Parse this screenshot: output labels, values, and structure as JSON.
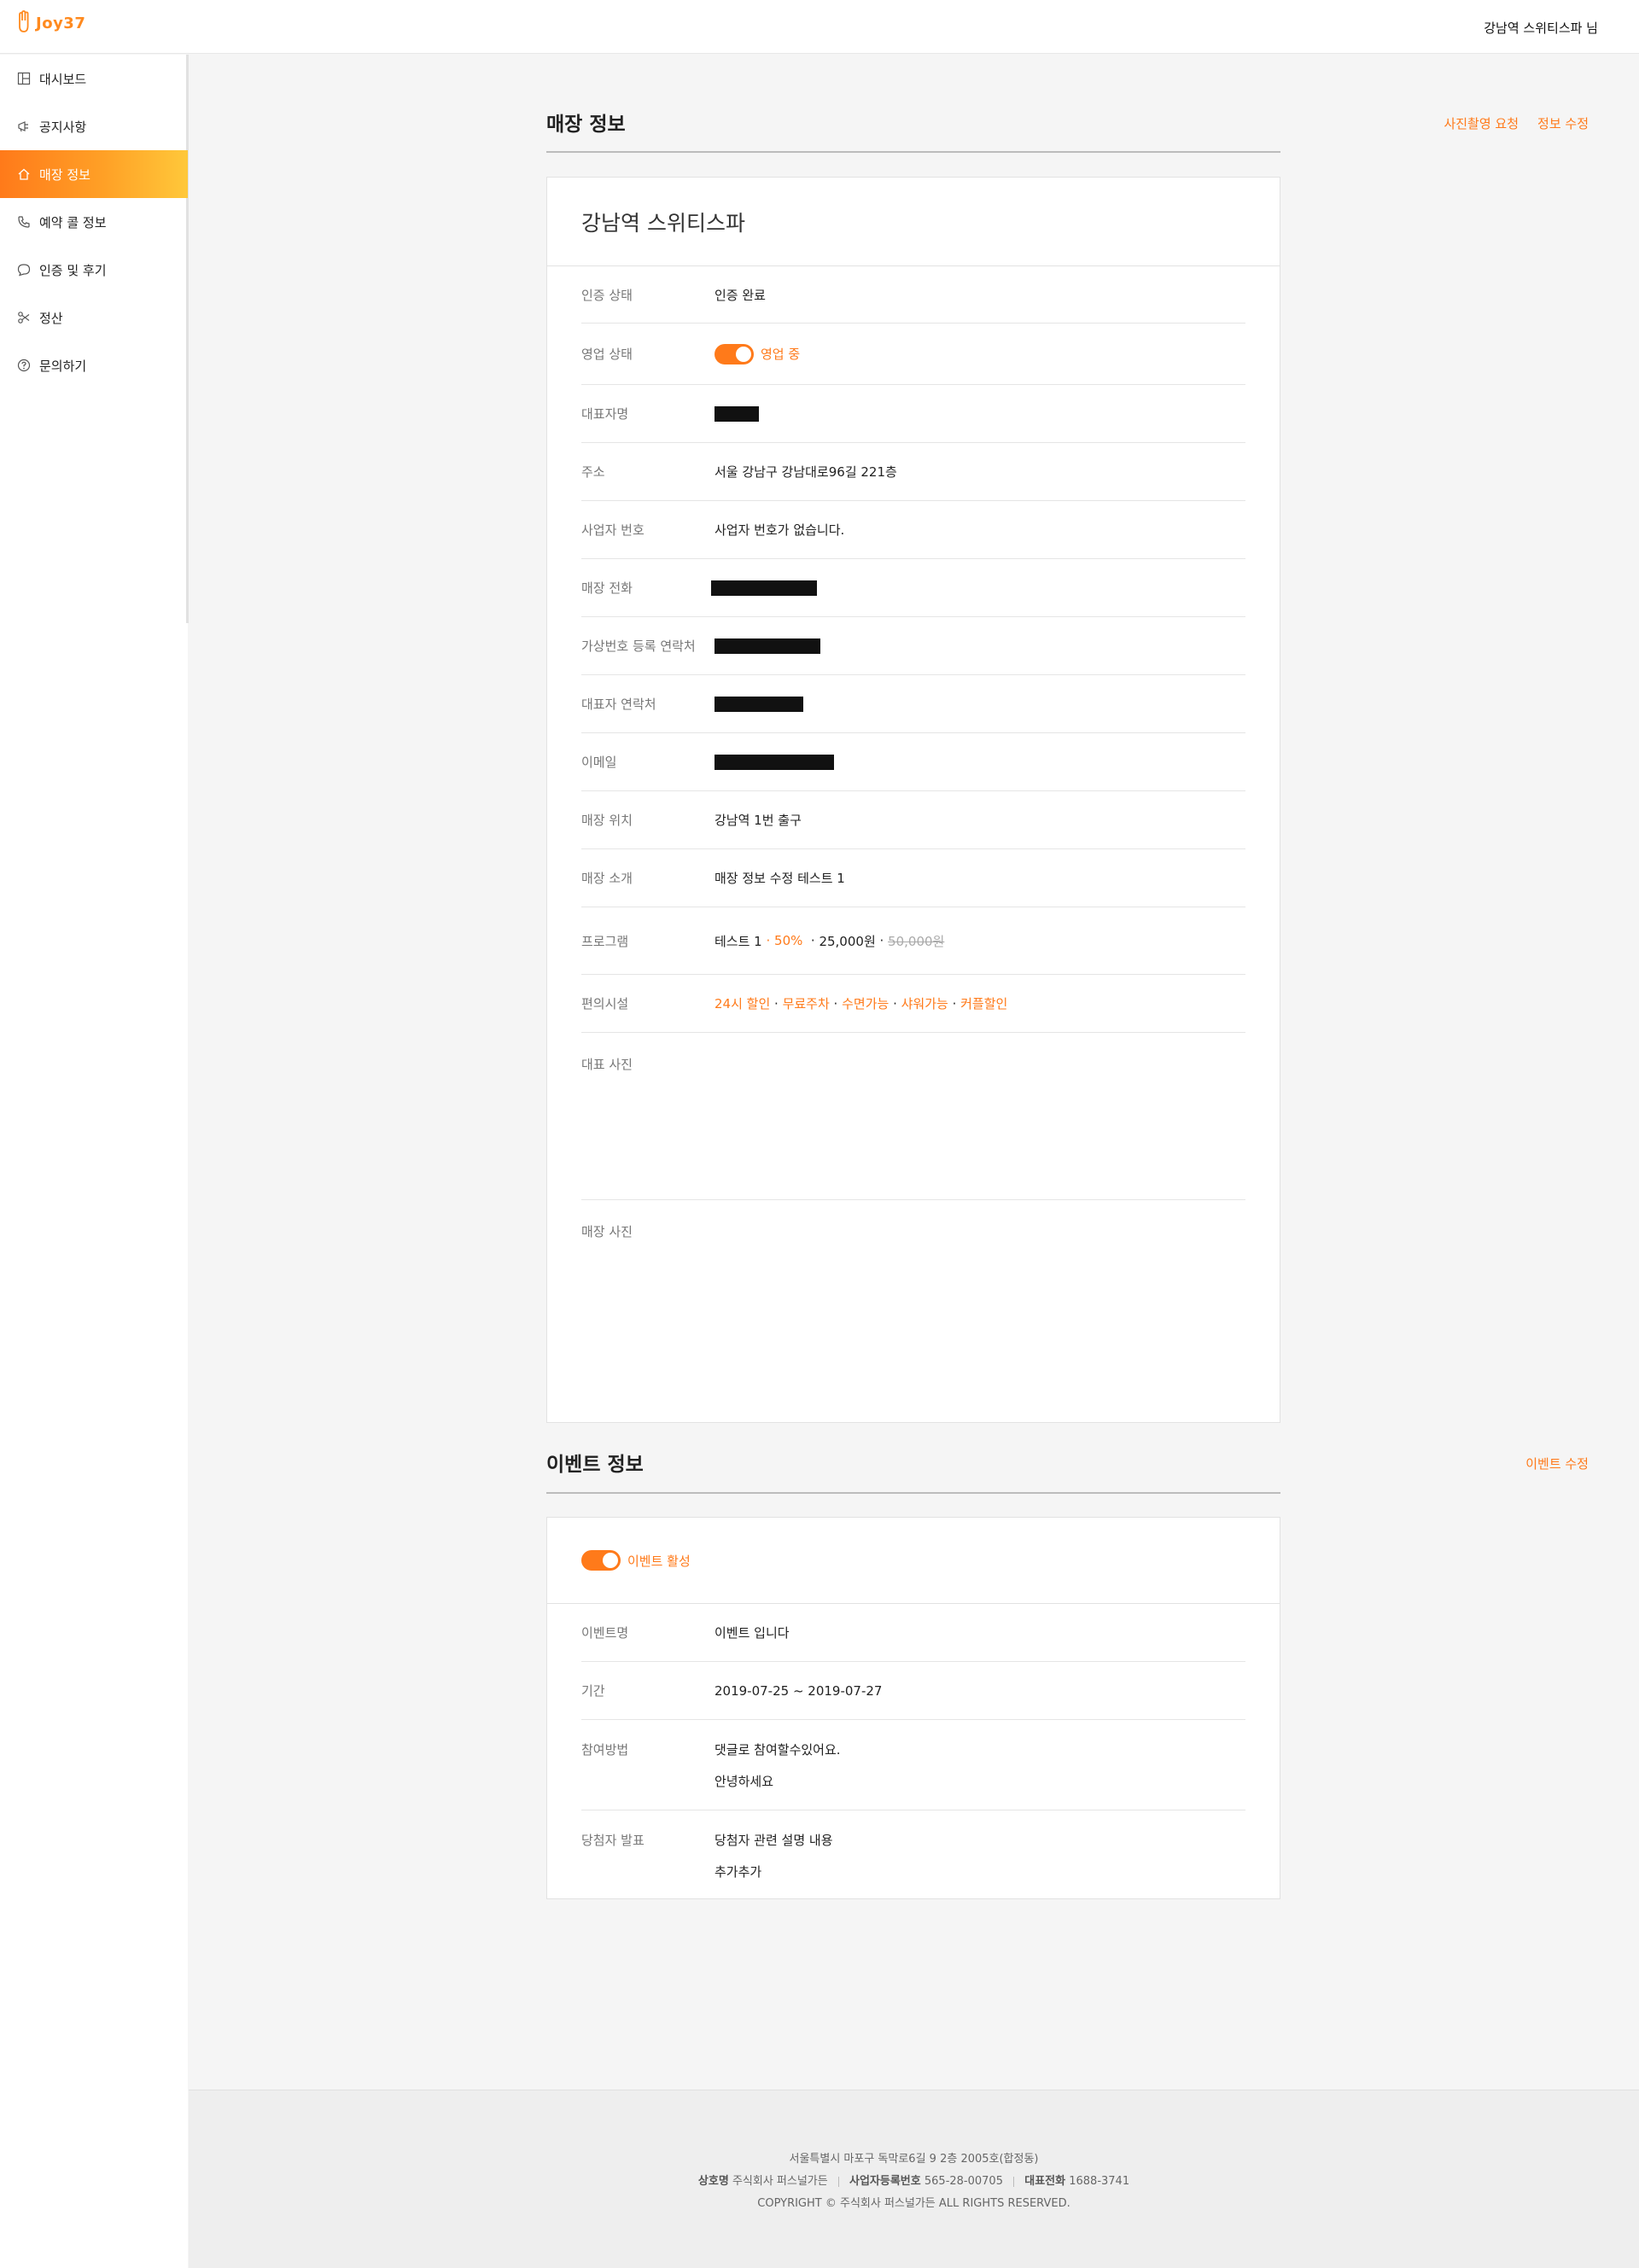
{
  "header": {
    "logo_text": "Joy37",
    "user_label": "강남역 스위티스파 님"
  },
  "sidebar": {
    "items": [
      {
        "label": "대시보드",
        "icon": "dashboard-icon"
      },
      {
        "label": "공지사항",
        "icon": "megaphone-icon"
      },
      {
        "label": "매장 정보",
        "icon": "home-icon",
        "active": true
      },
      {
        "label": "예약 콜 정보",
        "icon": "phone-icon"
      },
      {
        "label": "인증 및 후기",
        "icon": "chat-bubble-icon"
      },
      {
        "label": "정산",
        "icon": "scissors-icon"
      },
      {
        "label": "문의하기",
        "icon": "question-icon"
      }
    ]
  },
  "store_section": {
    "title": "매장 정보",
    "actions": {
      "photo_request": "사진촬영 요청",
      "edit_info": "정보 수정"
    },
    "store_name": "강남역 스위티스파",
    "labels": {
      "cert_status": "인증 상태",
      "business_status": "영업 상태",
      "owner_name": "대표자명",
      "address": "주소",
      "business_number": "사업자 번호",
      "store_phone": "매장 전화",
      "virtual_number": "가상번호 등록 연락처",
      "owner_phone": "대표자 연락처",
      "email": "이메일",
      "location": "매장 위치",
      "intro": "매장 소개",
      "program": "프로그램",
      "facilities": "편의시설",
      "main_photo": "대표 사진",
      "store_photo": "매장 사진"
    },
    "values": {
      "cert_status": "인증 완료",
      "business_status": "영업 중",
      "business_toggle_on": true,
      "address": "서울 강남구 강남대로96길 221층",
      "business_number": "사업자 번호가 없습니다.",
      "location": "강남역 1번 출구",
      "intro": "매장 정보 수정 테스트 1",
      "program": {
        "name": "테스트 1",
        "discount": "50%",
        "price": "25,000원",
        "original_price": "50,000원"
      },
      "facilities": [
        "24시 할인",
        "무료주차",
        "수면가능",
        "샤워가능",
        "커플할인"
      ]
    }
  },
  "event_section": {
    "title": "이벤트 정보",
    "actions": {
      "edit_event": "이벤트 수정"
    },
    "active_label": "이벤트 활성",
    "active_toggle_on": true,
    "labels": {
      "event_name": "이벤트명",
      "period": "기간",
      "participation": "참여방법",
      "winner": "당첨자 발표"
    },
    "values": {
      "event_name": "이벤트 입니다",
      "period": "2019-07-25 ~ 2019-07-27",
      "participation": [
        "댓글로 참여할수있어요.",
        "안녕하세요"
      ],
      "winner": [
        "당첨자 관련 설명 내용",
        "추가추가"
      ]
    }
  },
  "footer": {
    "address": "서울특별시 마포구 독막로6길 9 2층 2005호(합정동)",
    "company_label": "상호명",
    "company": "주식회사 퍼스널가든",
    "biz_label": "사업자등록번호",
    "biz_number": "565-28-00705",
    "phone_label": "대표전화",
    "phone": "1688-3741",
    "copyright": "COPYRIGHT © 주식회사 퍼스널가든 ALL RIGHTS RESERVED."
  },
  "colors": {
    "accent": "#ff7a1a",
    "accent_light": "#ffc83a"
  }
}
